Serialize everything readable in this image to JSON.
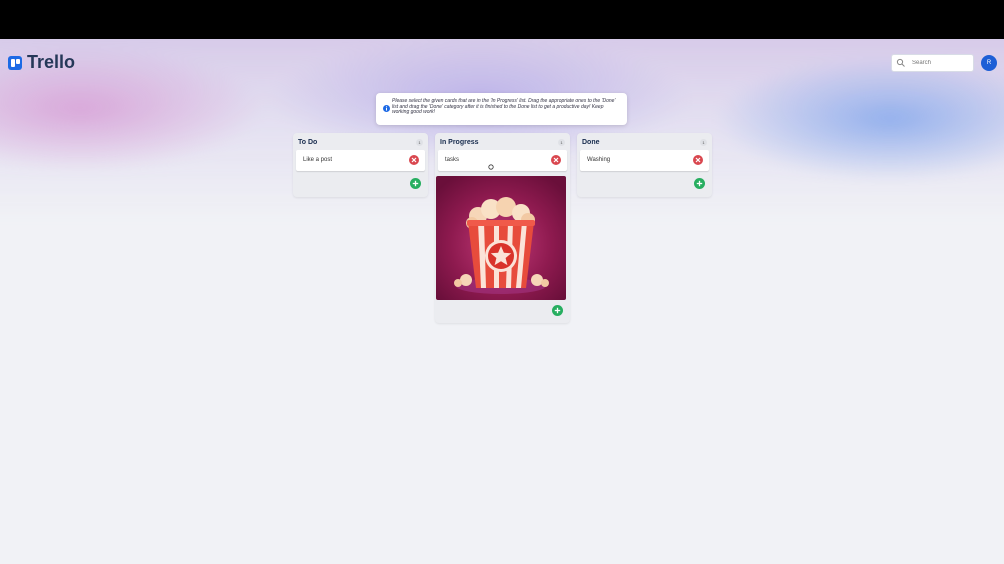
{
  "app": {
    "name": "Trello"
  },
  "search": {
    "placeholder": "Search"
  },
  "user": {
    "initial": "R"
  },
  "notice": {
    "text": "Please select the given cards that are in the 'In Progress' list. Drag the appropriate ones to the 'Done' list and drag the 'Done' category after it is finished to the Done list to get a productive day! Keep working good work!"
  },
  "columns": [
    {
      "title": "To Do",
      "count": "1",
      "cards": [
        {
          "text": "Like a post"
        }
      ]
    },
    {
      "title": "In Progress",
      "count": "1",
      "cards": [
        {
          "text": "tasks"
        }
      ]
    },
    {
      "title": "Done",
      "count": "1",
      "cards": [
        {
          "text": "Washing"
        }
      ]
    }
  ],
  "colors": {
    "brand": "#1d6ae5",
    "add": "#27ae60",
    "delete": "#d9474f"
  }
}
